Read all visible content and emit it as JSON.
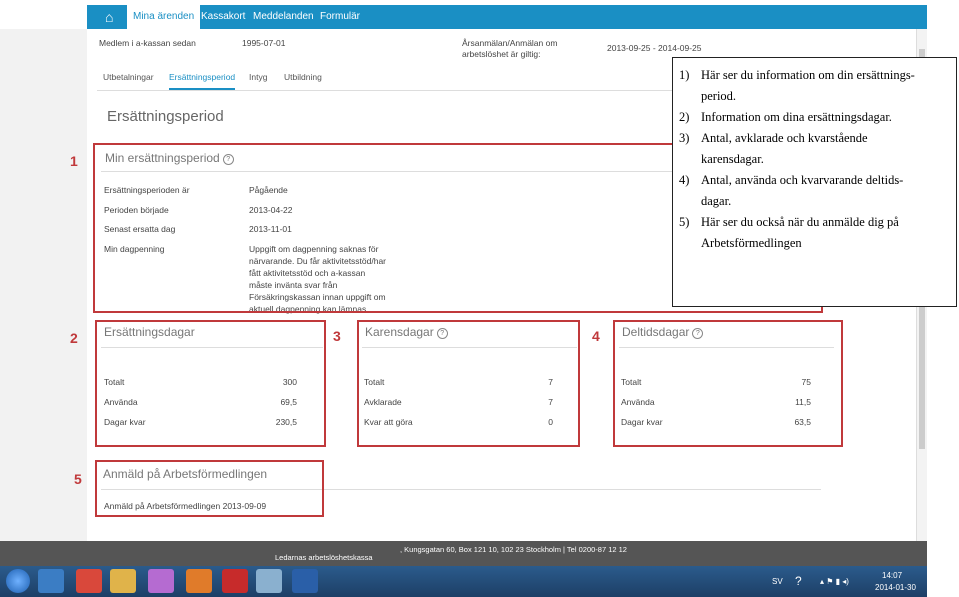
{
  "nav": {
    "tabs": [
      "Mina ärenden",
      "Kassakort",
      "Meddelanden",
      "Formulär"
    ],
    "active_tab": "Mina ärenden"
  },
  "member": {
    "label": "Medlem i a-kassan sedan",
    "value": "1995-07-01",
    "period_label": "Årsanmälan/Anmälan om arbetslöshet är giltig:",
    "period_label_line1": "Årsanmälan/Anmälan om",
    "period_label_line2": "arbetslöshet är giltig:",
    "period_value": "2013-09-25 - 2014-09-25"
  },
  "subtabs": [
    "Utbetalningar",
    "Ersättningsperiod",
    "Intyg",
    "Utbildning"
  ],
  "active_subtab": "Ersättningsperiod",
  "page_title": "Ersättningsperiod",
  "my_period": {
    "heading": "Min ersättningsperiod",
    "rows": [
      {
        "label": "Ersättningsperioden är",
        "value": "Pågående"
      },
      {
        "label": "Perioden började",
        "value": "2013-04-22"
      },
      {
        "label": "Senast ersatta dag",
        "value": "2013-11-01"
      },
      {
        "label": "Min dagpenning",
        "value": "Uppgift om dagpenning saknas för närvarande. Du får aktivitetsstöd/har fått aktivitetsstöd och a-kassan måste invänta svar från Försäkringskassan innan uppgift om aktuell dagpenning kan lämnas."
      }
    ],
    "dagpenning_lines": [
      "Uppgift om dagpenning saknas för",
      "närvarande. Du får aktivitetsstöd/har",
      "fått aktivitetsstöd och a-kassan",
      "måste invänta svar från",
      "Försäkringskassan innan uppgift om",
      "aktuell dagpenning kan lämnas."
    ]
  },
  "ersattningsdagar": {
    "heading": "Ersättningsdagar",
    "rows": [
      {
        "label": "Totalt",
        "value": "300"
      },
      {
        "label": "Använda",
        "value": "69,5"
      },
      {
        "label": "Dagar kvar",
        "value": "230,5"
      }
    ]
  },
  "karensdagar": {
    "heading": "Karensdagar",
    "rows": [
      {
        "label": "Totalt",
        "value": "7"
      },
      {
        "label": "Avklarade",
        "value": "7"
      },
      {
        "label": "Kvar att göra",
        "value": "0"
      }
    ]
  },
  "deltidsdagar": {
    "heading": "Deltidsdagar",
    "rows": [
      {
        "label": "Totalt",
        "value": "75"
      },
      {
        "label": "Använda",
        "value": "11,5"
      },
      {
        "label": "Dagar kvar",
        "value": "63,5"
      }
    ]
  },
  "af": {
    "heading": "Anmäld på Arbetsförmedlingen",
    "text": "Anmäld på Arbetsförmedlingen 2013-09-09"
  },
  "footer": {
    "org": "Ledarnas arbetslöshetskassa",
    "address": ", Kungsgatan 60, Box 121 10, 102 23 Stockholm | Tel 0200-87 12 12"
  },
  "markers": [
    "1",
    "2",
    "3",
    "4",
    "5"
  ],
  "annotation": {
    "items": [
      {
        "n": "1)",
        "text": "Här ser du information om din ersättnings-",
        "cont": "period."
      },
      {
        "n": "2)",
        "text": "Information om dina ersättningsdagar."
      },
      {
        "n": "3)",
        "text": "Antal, avklarade och kvarstående",
        "cont": "karensdagar."
      },
      {
        "n": "4)",
        "text": "Antal, använda och kvarvarande deltids-",
        "cont": "dagar."
      },
      {
        "n": "5)",
        "text": "Här ser du också när du anmälde dig på",
        "cont": "Arbetsförmedlingen"
      }
    ]
  },
  "taskbar": {
    "lang": "SV",
    "time": "14:07",
    "date": "2014-01-30"
  },
  "colors": {
    "accent": "#1a8fc4",
    "highlight": "#c0393b"
  }
}
